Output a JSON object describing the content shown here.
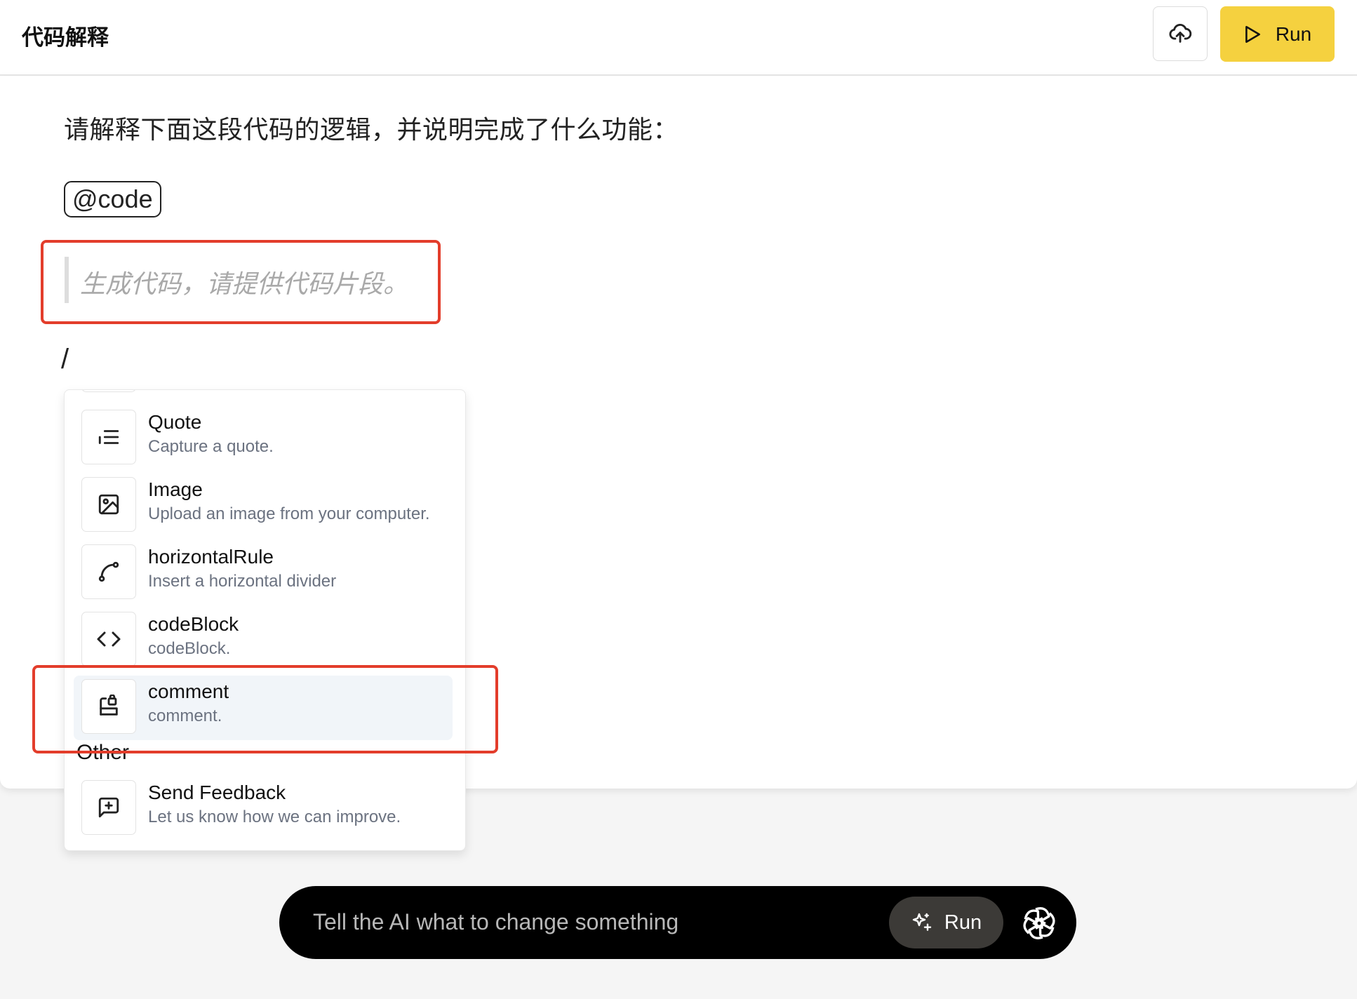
{
  "header": {
    "title": "代码解释",
    "upload_icon": "cloud-upload-icon",
    "run_label": "Run",
    "run_color": "#f5d13f"
  },
  "editor": {
    "prompt_text": "请解释下面这段代码的逻辑，并说明完成了什么功能：",
    "chip": "@code",
    "placeholder": "生成代码，请提供代码片段。",
    "slash": "/"
  },
  "menu": {
    "items": [
      {
        "title": "Quote",
        "desc": "Capture a quote.",
        "icon": "quote-icon"
      },
      {
        "title": "Image",
        "desc": "Upload an image from your computer.",
        "icon": "image-icon"
      },
      {
        "title": "horizontalRule",
        "desc": "Insert a horizontal divider",
        "icon": "curve-icon"
      },
      {
        "title": "codeBlock",
        "desc": "codeBlock.",
        "icon": "code-icon"
      },
      {
        "title": "comment",
        "desc": "comment.",
        "icon": "comment-icon",
        "active": true
      }
    ],
    "section_other": "Other",
    "other_items": [
      {
        "title": "Send Feedback",
        "desc": "Let us know how we can improve.",
        "icon": "feedback-icon"
      }
    ]
  },
  "ai_bar": {
    "placeholder": "Tell the AI what to change something",
    "run_label": "Run",
    "icon": "sparkle-icon",
    "logo": "openai-logo"
  },
  "colors": {
    "highlight_box": "#e33d2b",
    "active_item_bg": "#f1f5f9"
  }
}
